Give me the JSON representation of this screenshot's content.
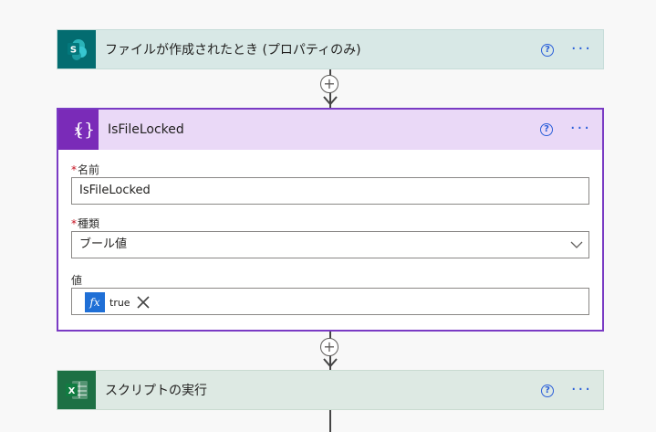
{
  "window": {
    "breadcrumb": "",
    "toolbar_right": ""
  },
  "steps": [
    {
      "id": "trigger",
      "title": "ファイルが作成されたとき (プロパティのみ)",
      "icon": "sharepoint-icon",
      "color": "#036c70"
    },
    {
      "id": "variable",
      "title": "IsFileLocked",
      "icon": "variable-icon",
      "color": "#7a2bb8",
      "fields": {
        "name_label": "名前",
        "name_value": "IsFileLocked",
        "type_label": "種類",
        "type_value": "ブール値",
        "value_label": "値",
        "value_token": "true",
        "token_badge": "fx"
      }
    },
    {
      "id": "script",
      "title": "スクリプトの実行",
      "icon": "excel-icon",
      "color": "#1d7044"
    }
  ],
  "common": {
    "help_glyph": "?",
    "more_glyph": "···",
    "plus_glyph": "+",
    "required_mark": "*"
  }
}
